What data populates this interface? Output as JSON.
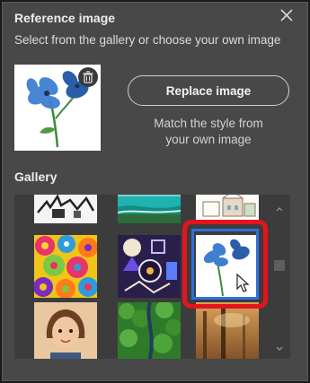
{
  "panel": {
    "title": "Reference image",
    "subtitle": "Select from the gallery or choose your own image",
    "close_icon": "close-icon"
  },
  "reference": {
    "thumbnail_desc_icon": "blue-flowers-thumbnail",
    "delete_icon": "trash-icon",
    "replace_label": "Replace image",
    "hint_line1": "Match the style from",
    "hint_line2": "your own image"
  },
  "gallery": {
    "title": "Gallery",
    "tiles": [
      {
        "name": "sketch-city"
      },
      {
        "name": "tropical-beach"
      },
      {
        "name": "watercolor-buildings"
      },
      {
        "name": "paper-flowers"
      },
      {
        "name": "geometric-shapes"
      },
      {
        "name": "blue-flowers",
        "selected": true
      },
      {
        "name": "cartoon-portrait"
      },
      {
        "name": "forest-aerial"
      },
      {
        "name": "foggy-forest"
      }
    ]
  },
  "colors": {
    "panel_bg": "#484848",
    "highlight_red": "#e4141c",
    "selection_blue": "#2f6fe0",
    "flower_blue": "#3f7fd0"
  }
}
